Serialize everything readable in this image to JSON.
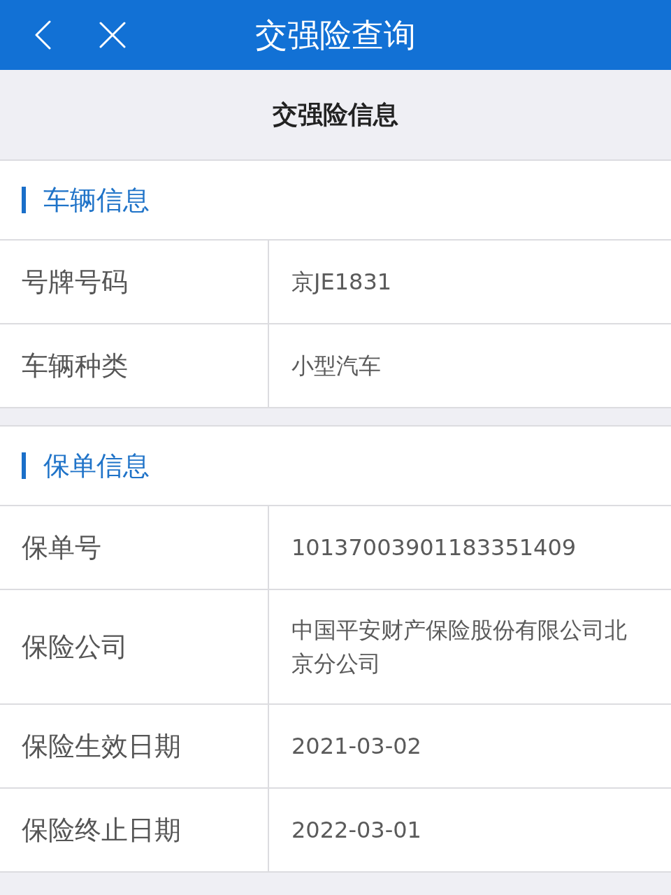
{
  "nav_bar": {
    "title": "交强险查询"
  },
  "page_title": "交强险信息",
  "sections": [
    {
      "title": "车辆信息",
      "rows": [
        {
          "label": "号牌号码",
          "value": "京JE1831"
        },
        {
          "label": "车辆种类",
          "value": "小型汽车"
        }
      ]
    },
    {
      "title": "保单信息",
      "rows": [
        {
          "label": "保单号",
          "value": "10137003901183351409"
        },
        {
          "label": "保险公司",
          "value": "中国平安财产保险股份有限公司北京分公司"
        },
        {
          "label": "保险生效日期",
          "value": "2021-03-02"
        },
        {
          "label": "保险终止日期",
          "value": "2022-03-01"
        }
      ]
    }
  ]
}
